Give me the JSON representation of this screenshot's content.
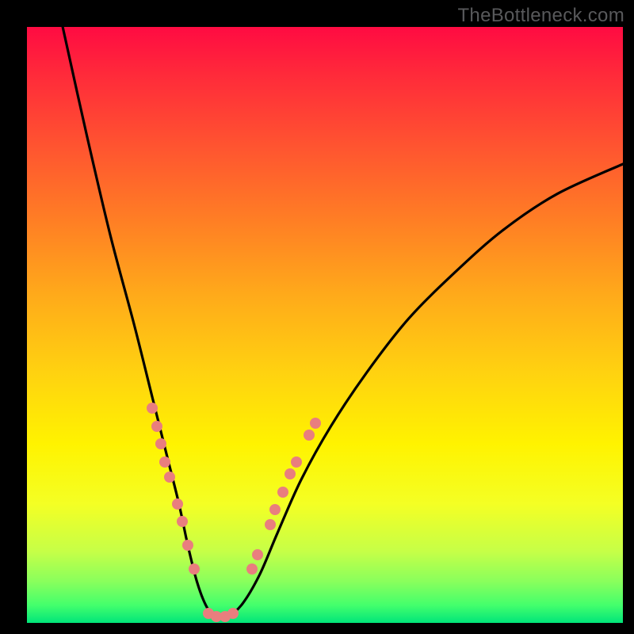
{
  "watermark": "TheBottleneck.com",
  "colors": {
    "dot": "#e97e7e",
    "curve": "#000000",
    "frame": "#000000"
  },
  "chart_data": {
    "type": "line",
    "title": "",
    "xlabel": "",
    "ylabel": "",
    "xlim": [
      0,
      100
    ],
    "ylim": [
      0,
      100
    ],
    "series": [
      {
        "name": "bottleneck-curve",
        "x": [
          6,
          10,
          14,
          18,
          21,
          23.5,
          25.5,
          27,
          28.5,
          30,
          31.5,
          33.5,
          36,
          39,
          42,
          46,
          51,
          57,
          64,
          72,
          80,
          89,
          100
        ],
        "y": [
          100,
          82,
          65,
          50,
          38,
          28,
          20,
          13,
          7,
          3,
          1,
          1,
          3,
          8,
          15,
          24,
          33,
          42,
          51,
          59,
          66,
          72,
          77
        ]
      }
    ],
    "dots_left": [
      {
        "x": 21.0,
        "y": 36
      },
      {
        "x": 21.8,
        "y": 33
      },
      {
        "x": 22.5,
        "y": 30
      },
      {
        "x": 23.2,
        "y": 27
      },
      {
        "x": 24.0,
        "y": 24.5
      },
      {
        "x": 25.3,
        "y": 20
      },
      {
        "x": 26.0,
        "y": 17
      },
      {
        "x": 27.0,
        "y": 13
      },
      {
        "x": 28.0,
        "y": 9
      }
    ],
    "dots_valley": [
      {
        "x": 30.5,
        "y": 1.6
      },
      {
        "x": 31.8,
        "y": 1.1
      },
      {
        "x": 33.3,
        "y": 1.1
      },
      {
        "x": 34.6,
        "y": 1.6
      }
    ],
    "dots_right": [
      {
        "x": 37.7,
        "y": 9
      },
      {
        "x": 38.7,
        "y": 11.5
      },
      {
        "x": 40.8,
        "y": 16.5
      },
      {
        "x": 41.6,
        "y": 19
      },
      {
        "x": 43.0,
        "y": 22
      },
      {
        "x": 44.2,
        "y": 25
      },
      {
        "x": 45.2,
        "y": 27
      },
      {
        "x": 47.4,
        "y": 31.5
      },
      {
        "x": 48.4,
        "y": 33.5
      }
    ]
  }
}
